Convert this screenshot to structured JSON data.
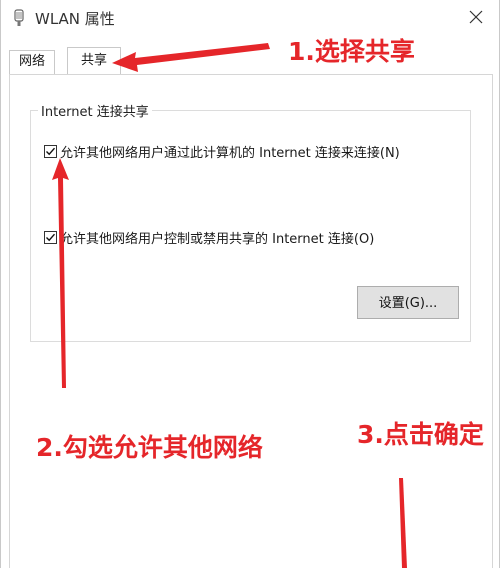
{
  "window": {
    "title": "WLAN 属性"
  },
  "tabs": [
    {
      "label": "网络"
    },
    {
      "label": "共享"
    }
  ],
  "group": {
    "legend": "Internet 连接共享",
    "checkbox1": {
      "label": "允许其他网络用户通过此计算机的 Internet 连接来连接(N)",
      "checked": true
    },
    "checkbox2": {
      "label": "允许其他网络用户控制或禁用共享的 Internet 连接(O)",
      "checked": true
    },
    "settings_button": "设置(G)..."
  },
  "annotations": {
    "step1": "1.选择共享",
    "step2": "2.勾选允许其他网络",
    "step3": "3.点击确定"
  },
  "colors": {
    "annotation_red": "#e5262a"
  },
  "icons": [
    "wlan-icon",
    "close-icon",
    "checkmark-icon"
  ]
}
